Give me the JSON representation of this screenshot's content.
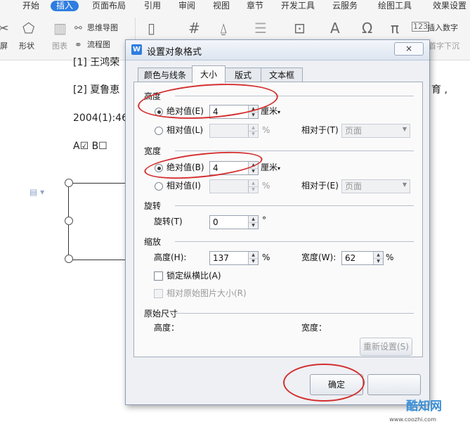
{
  "menu": [
    "开始",
    "插入",
    "页面布局",
    "引用",
    "审阅",
    "视图",
    "章节",
    "开发工具",
    "云服务",
    "绘图工具",
    "效果设置"
  ],
  "ribbon": {
    "cut_label": "屏",
    "shape_label": "形状",
    "chart_label": "图表",
    "mindmap_label": "思维导图",
    "flowchart_label": "流程图",
    "insert_number_label": "插入数字",
    "dropcap_label": "首字下沉"
  },
  "document": {
    "ref1": "[1] 王鸿荣",
    "ref2": "[2] 夏鲁恵",
    "ref2_tail": "育 ,",
    "ref2_year": "2004(1):46",
    "checkbox_line": "A☑  B☐"
  },
  "dialog": {
    "title": "设置对象格式",
    "close_label": "×",
    "tabs": [
      "颜色与线条",
      "大小",
      "版式",
      "文本框"
    ],
    "height_section": {
      "title": "高度",
      "absolute_label": "绝对值(E)",
      "absolute_value": "4",
      "absolute_unit": "厘米",
      "relative_label": "相对值(L)",
      "relative_unit": "%",
      "relative_to_label": "相对于(T)",
      "relative_to_value": "页面"
    },
    "width_section": {
      "title": "宽度",
      "absolute_label": "绝对值(B)",
      "absolute_value": "4",
      "absolute_unit": "厘米",
      "relative_label": "相对值(I)",
      "relative_unit": "%",
      "relative_to_label": "相对于(E)",
      "relative_to_value": "页面"
    },
    "rotate_section": {
      "title": "旋转",
      "label": "旋转(T)",
      "value": "0",
      "unit": "°"
    },
    "scale_section": {
      "title": "缩放",
      "height_label": "高度(H):",
      "height_value": "137",
      "width_label": "宽度(W):",
      "width_value": "62",
      "unit": "%",
      "lock_ratio_label": "锁定纵横比(A)",
      "relative_original_label": "相对原始图片大小(R)"
    },
    "original_section": {
      "title": "原始尺寸",
      "height_label": "高度：",
      "width_label": "宽度：",
      "reset_label": "重新设置(S)"
    },
    "ok_label": "确定"
  },
  "watermark": {
    "brand": "酷知网",
    "url": "www.coozhi.com"
  },
  "colors": {
    "accent": "#2f7de0",
    "annotation": "#d32f2f"
  },
  "icons": [
    "unit-dropdown-icon",
    "spin-up-icon",
    "spin-down-icon",
    "select-arrow-icon",
    "word-logo-icon"
  ]
}
